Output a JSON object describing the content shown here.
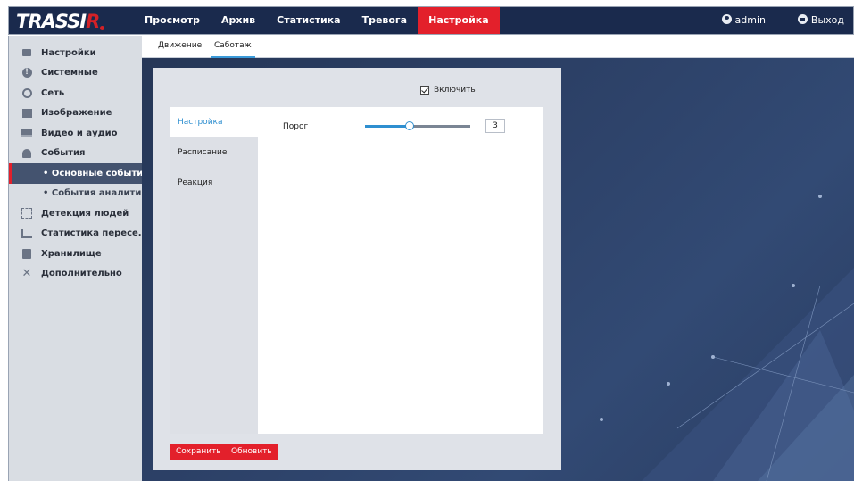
{
  "header": {
    "logo": {
      "main": "TRASSI",
      "accent": "R"
    },
    "nav": [
      "Просмотр",
      "Архив",
      "Статистика",
      "Тревога",
      "Настройка"
    ],
    "active_nav": "Настройка",
    "user": "admin",
    "logout": "Выход"
  },
  "sidebar": {
    "items": [
      {
        "label": "Настройки",
        "icon": "settings-icon"
      },
      {
        "label": "Системные",
        "icon": "info-icon"
      },
      {
        "label": "Сеть",
        "icon": "globe-icon"
      },
      {
        "label": "Изображение",
        "icon": "image-icon"
      },
      {
        "label": "Видео и аудио",
        "icon": "monitor-icon"
      },
      {
        "label": "События",
        "icon": "bell-icon"
      },
      {
        "label": "• Основные события",
        "sub": true,
        "selected": true
      },
      {
        "label": "• События аналитики",
        "sub": true
      },
      {
        "label": "Детекция людей",
        "icon": "person-detect-icon"
      },
      {
        "label": "Статистика пересе...",
        "icon": "chart-icon"
      },
      {
        "label": "Хранилище",
        "icon": "disk-icon"
      },
      {
        "label": "Дополнительно",
        "icon": "tools-icon"
      }
    ]
  },
  "subtabs": {
    "motion": "Движение",
    "sabotage": "Саботаж",
    "active": "Саботаж"
  },
  "panel": {
    "enable_label": "Включить",
    "enable_checked": true,
    "vtabs": {
      "settings": "Настройка",
      "schedule": "Расписание",
      "reaction": "Реакция"
    },
    "threshold_label": "Порог",
    "threshold_value": "3",
    "threshold_fraction": 0.42
  },
  "buttons": {
    "save": "Сохранить",
    "refresh": "Обновить"
  },
  "colors": {
    "accent_red": "#e3202b",
    "header_bg": "#1a2a4d",
    "link_blue": "#2f8fd0"
  }
}
